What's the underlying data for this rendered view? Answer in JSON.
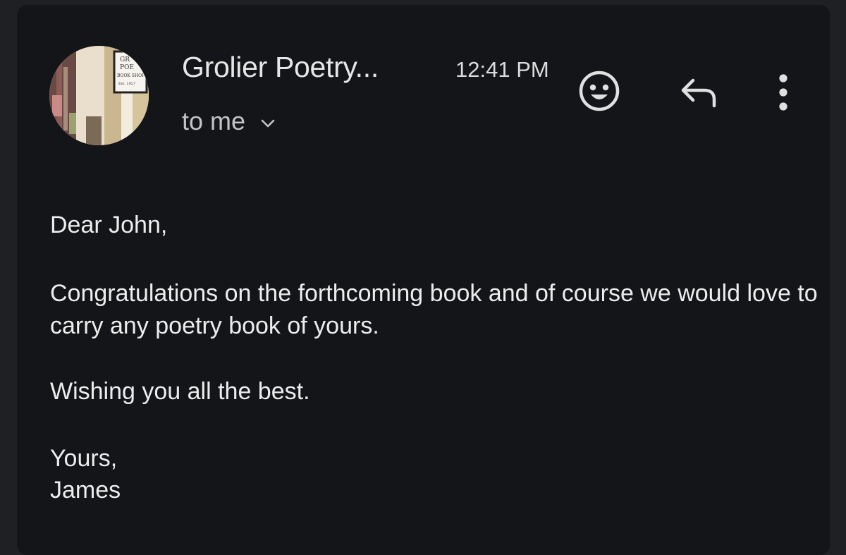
{
  "header": {
    "sender_name": "Grolier Poetry...",
    "time": "12:41 PM",
    "recipient": "to me"
  },
  "avatar": {
    "sign_lines": [
      "GR",
      "POE",
      "BOOK SHOP",
      "Est. 1927"
    ]
  },
  "icons": {
    "emoji": "smiley-face-icon",
    "reply": "reply-arrow-icon",
    "more": "more-vertical-icon",
    "expand": "chevron-down-icon"
  },
  "message": {
    "greeting": "Dear John,",
    "paragraph_1": "Congratulations on the forthcoming book and of course we would love to carry any poetry book of yours.",
    "paragraph_2": "Wishing you all the best.",
    "signoff": "Yours,",
    "signature": "James"
  },
  "colors": {
    "background": "#1f2024",
    "card": "#141519",
    "text_primary": "#ededed",
    "icon": "#e0e0e0"
  }
}
